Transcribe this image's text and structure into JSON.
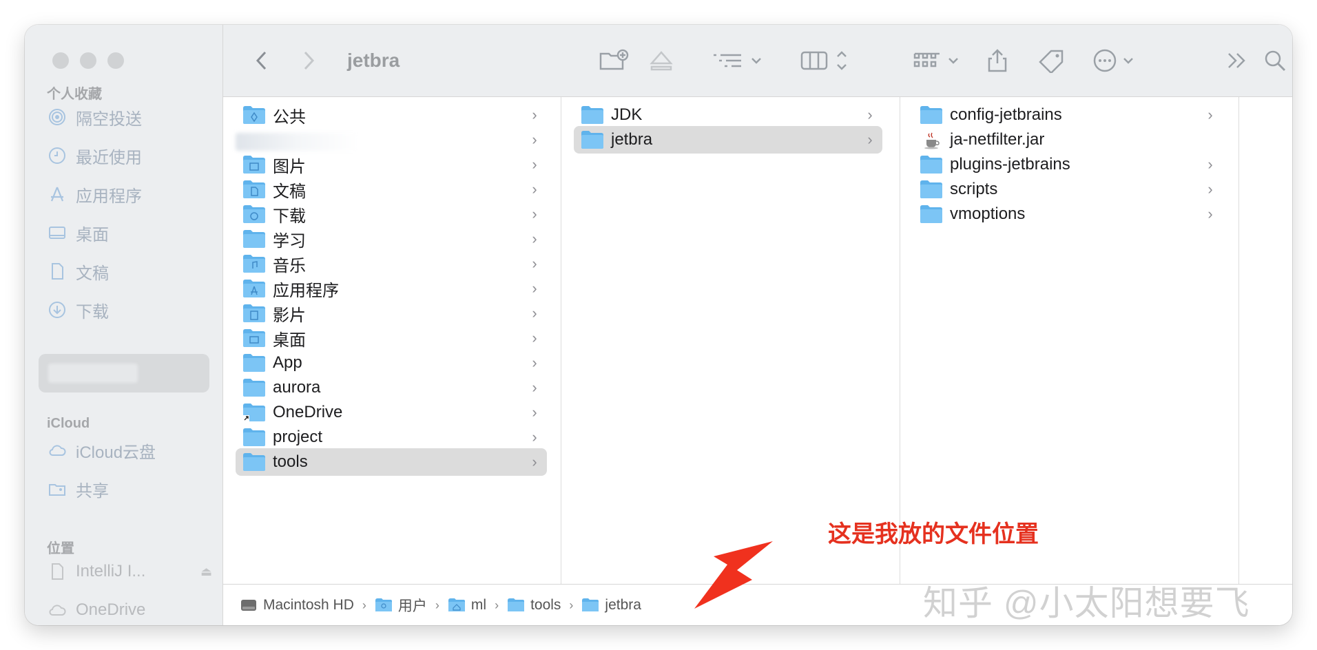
{
  "window": {
    "title": "jetbra"
  },
  "sidebar": {
    "favorites_header": "个人收藏",
    "favorites": [
      {
        "label": "隔空投送",
        "icon": "airdrop-icon"
      },
      {
        "label": "最近使用",
        "icon": "clock-icon"
      },
      {
        "label": "应用程序",
        "icon": "apps-icon"
      },
      {
        "label": "桌面",
        "icon": "desktop-icon"
      },
      {
        "label": "文稿",
        "icon": "document-icon"
      },
      {
        "label": "下载",
        "icon": "download-icon"
      }
    ],
    "icloud_header": "iCloud",
    "icloud": [
      {
        "label": "iCloud云盘",
        "icon": "cloud-icon"
      },
      {
        "label": "共享",
        "icon": "shared-folder-icon"
      }
    ],
    "locations_header": "位置",
    "locations": [
      {
        "label": "IntelliJ I...",
        "icon": "disk-icon"
      },
      {
        "label": "OneDrive",
        "icon": "cloud-icon"
      }
    ]
  },
  "columns": {
    "col1": [
      {
        "label": "公共"
      },
      {
        "label": ""
      },
      {
        "label": "图片"
      },
      {
        "label": "文稿"
      },
      {
        "label": "下载"
      },
      {
        "label": "学习"
      },
      {
        "label": "音乐"
      },
      {
        "label": "应用程序"
      },
      {
        "label": "影片"
      },
      {
        "label": "桌面"
      },
      {
        "label": "App"
      },
      {
        "label": "aurora"
      },
      {
        "label": "OneDrive"
      },
      {
        "label": "project"
      },
      {
        "label": "tools"
      }
    ],
    "col2": [
      {
        "label": "JDK"
      },
      {
        "label": "jetbra"
      }
    ],
    "col3": [
      {
        "label": "config-jetbrains"
      },
      {
        "label": "ja-netfilter.jar"
      },
      {
        "label": "plugins-jetbrains"
      },
      {
        "label": "scripts"
      },
      {
        "label": "vmoptions"
      }
    ]
  },
  "pathbar": {
    "items": [
      "Macintosh HD",
      "用户",
      "ml",
      "tools",
      "jetbra"
    ],
    "separator": "›"
  },
  "annotation": "这是我放的文件位置",
  "watermark": "知乎 @小太阳想要飞",
  "colors": {
    "folder": "#5fb3ec",
    "selection": "#dcdcdc",
    "annotation": "#e5311f"
  }
}
